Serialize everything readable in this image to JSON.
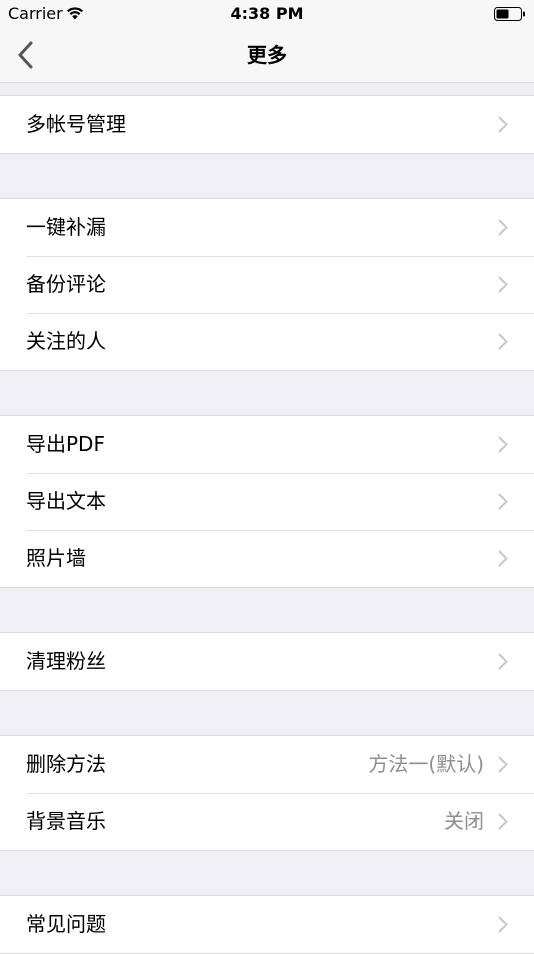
{
  "status_bar": {
    "carrier": "Carrier",
    "time": "4:38 PM"
  },
  "nav": {
    "title": "更多",
    "back_icon": "chevron-left-icon"
  },
  "groups": [
    {
      "items": [
        {
          "label": "多帐号管理"
        }
      ]
    },
    {
      "items": [
        {
          "label": "一键补漏"
        },
        {
          "label": "备份评论"
        },
        {
          "label": "关注的人"
        }
      ]
    },
    {
      "items": [
        {
          "label": "导出PDF"
        },
        {
          "label": "导出文本"
        },
        {
          "label": "照片墙"
        }
      ]
    },
    {
      "items": [
        {
          "label": "清理粉丝"
        }
      ]
    },
    {
      "items": [
        {
          "label": "删除方法",
          "value": "方法一(默认)"
        },
        {
          "label": "背景音乐",
          "value": "关闭"
        }
      ]
    },
    {
      "items": [
        {
          "label": "常见问题"
        }
      ]
    }
  ],
  "colors": {
    "background": "#efeff4",
    "cell": "#ffffff",
    "secondary_text": "#8e8e93",
    "chevron": "#c7c7cc",
    "nav_tint": "#555555"
  }
}
